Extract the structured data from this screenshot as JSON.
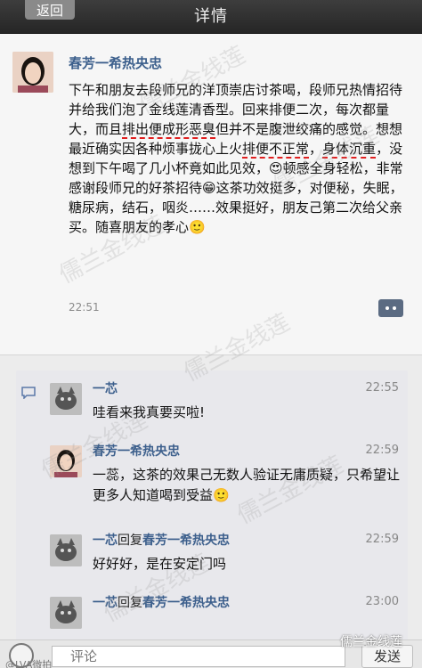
{
  "header": {
    "back_label": "返回",
    "title": "详情"
  },
  "post": {
    "author": "春芳一希热央忠",
    "body_part1": "下午和朋友去段师兄的洋顶崇店讨茶喝，段师兄热情招待并给我们泡了金线莲清香型。回来排便二次，每次都量大，而且",
    "body_hl1": "排出便成形恶臭",
    "body_part2": "但并不是腹泄绞痛的感觉。想想最近确实因各种烦事拢心上火",
    "body_hl2": "排便不正常",
    "body_part3": "，",
    "body_hl3": "身体沉重",
    "body_part4": "，没想到下午喝了几小杯竟如此见效，😍顿感全身轻松，非常感谢段师兄的好茶招待😁这茶功效挺多，对便秘，失眠，糖尿病，结石，咽炎……效果挺好，朋友己第二次给父亲买。随喜朋友的孝心🙂",
    "time": "22:51"
  },
  "comments": [
    {
      "name": "一芯",
      "reply_word": "",
      "reply_to": "",
      "time": "22:55",
      "text": "哇看来我真要买啦!"
    },
    {
      "name": "春芳一希热央忠",
      "reply_word": "",
      "reply_to": "",
      "time": "22:59",
      "text": "一蕊，这茶的效果己无数人验证无庸质疑，只希望让更多人知道喝到受益🙂"
    },
    {
      "name": "一芯",
      "reply_word": "回复",
      "reply_to": "春芳一希热央忠",
      "time": "22:59",
      "text": "好好好，是在安定门吗"
    },
    {
      "name": "一芯",
      "reply_word": "回复",
      "reply_to": "春芳一希热央忠",
      "time": "23:00",
      "text": ""
    }
  ],
  "input": {
    "placeholder": "评论",
    "send_label": "发送"
  },
  "watermark": {
    "text": "儒兰金线莲",
    "brand": "儒兰金线莲",
    "corner": "@LVA微拍"
  },
  "colors": {
    "name_blue": "#3c5f8c",
    "highlight_red": "#e02020"
  }
}
